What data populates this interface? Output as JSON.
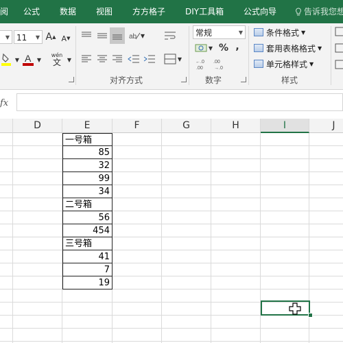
{
  "menu": {
    "tabs": [
      "阅",
      "公式",
      "数据",
      "视图",
      "方方格子",
      "DIY工具箱",
      "公式向导"
    ],
    "tell_me": "告诉我您想"
  },
  "ribbon": {
    "font_size": "11",
    "number_format": "常规",
    "currency": "",
    "percent": "%",
    "comma": ",",
    "phonetic": "wén",
    "style_items": [
      "条件格式",
      "套用表格格式",
      "单元格样式"
    ],
    "groups": {
      "alignment": "对齐方式",
      "number": "数字",
      "styles": "样式"
    }
  },
  "formula_bar": {
    "fx_label": "fx",
    "content": ""
  },
  "columns": [
    "D",
    "E",
    "F",
    "G",
    "H",
    "I",
    "J"
  ],
  "cells": [
    {
      "text": "一号箱",
      "kind": "txt"
    },
    {
      "text": "85",
      "kind": "num"
    },
    {
      "text": "32",
      "kind": "num"
    },
    {
      "text": "99",
      "kind": "num"
    },
    {
      "text": "34",
      "kind": "num"
    },
    {
      "text": "二号箱",
      "kind": "txt"
    },
    {
      "text": "56",
      "kind": "num"
    },
    {
      "text": "454",
      "kind": "num"
    },
    {
      "text": "三号箱",
      "kind": "txt"
    },
    {
      "text": "41",
      "kind": "num"
    },
    {
      "text": "7",
      "kind": "num"
    },
    {
      "text": "19",
      "kind": "num"
    }
  ],
  "colors": {
    "accent": "#217346",
    "font_red": "#c00000",
    "highlight_yellow": "#ffff00"
  }
}
